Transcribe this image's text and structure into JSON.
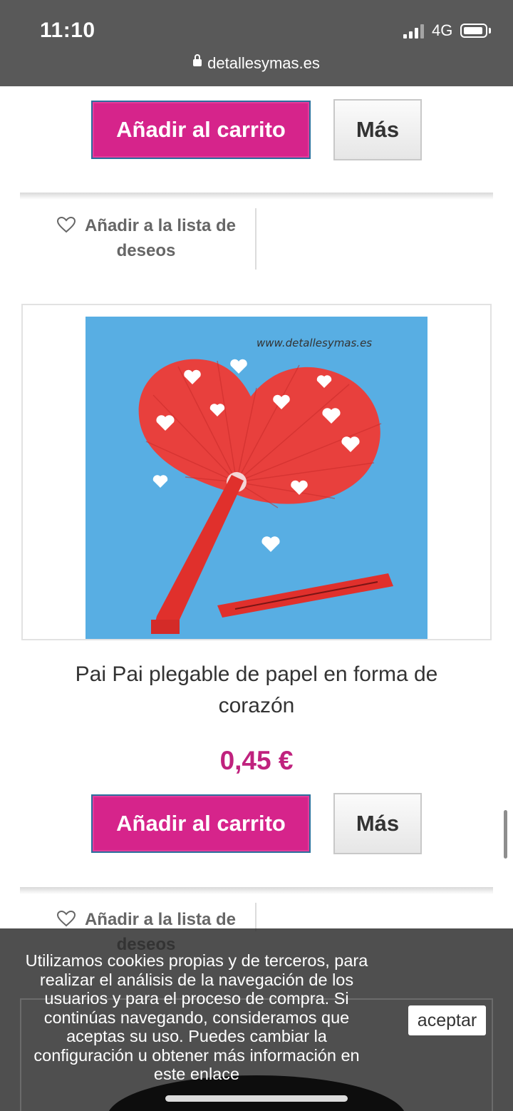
{
  "status": {
    "time": "11:10",
    "network": "4G"
  },
  "browser": {
    "url": "detallesymas.es"
  },
  "product_prev": {
    "add_to_cart": "Añadir al carrito",
    "more": "Más",
    "wishlist_line1": "Añadir a la lista de",
    "wishlist_line2": "deseos"
  },
  "product": {
    "watermark": "www.detallesymas.es",
    "title_line1": "Pai Pai plegable de papel en forma de",
    "title_line2": "corazón",
    "price": "0,45 €",
    "add_to_cart": "Añadir al carrito",
    "more": "Más",
    "wishlist_line1": "Añadir a la lista de",
    "wishlist_line2": "deseos"
  },
  "cookie": {
    "lines": [
      "Utilizamos cookies propias y de terceros, para",
      "realizar el análisis de la navegación de los",
      "usuarios y para el proceso de compra. Si",
      "continúas navegando, consideramos que",
      "aceptas su uso. Puedes cambiar la",
      "configuración u obtener más información en",
      "este enlace"
    ],
    "accept": "aceptar"
  },
  "colors": {
    "brand_pink": "#d6248b",
    "price_pink": "#c0227e",
    "status_bar": "#595959"
  }
}
